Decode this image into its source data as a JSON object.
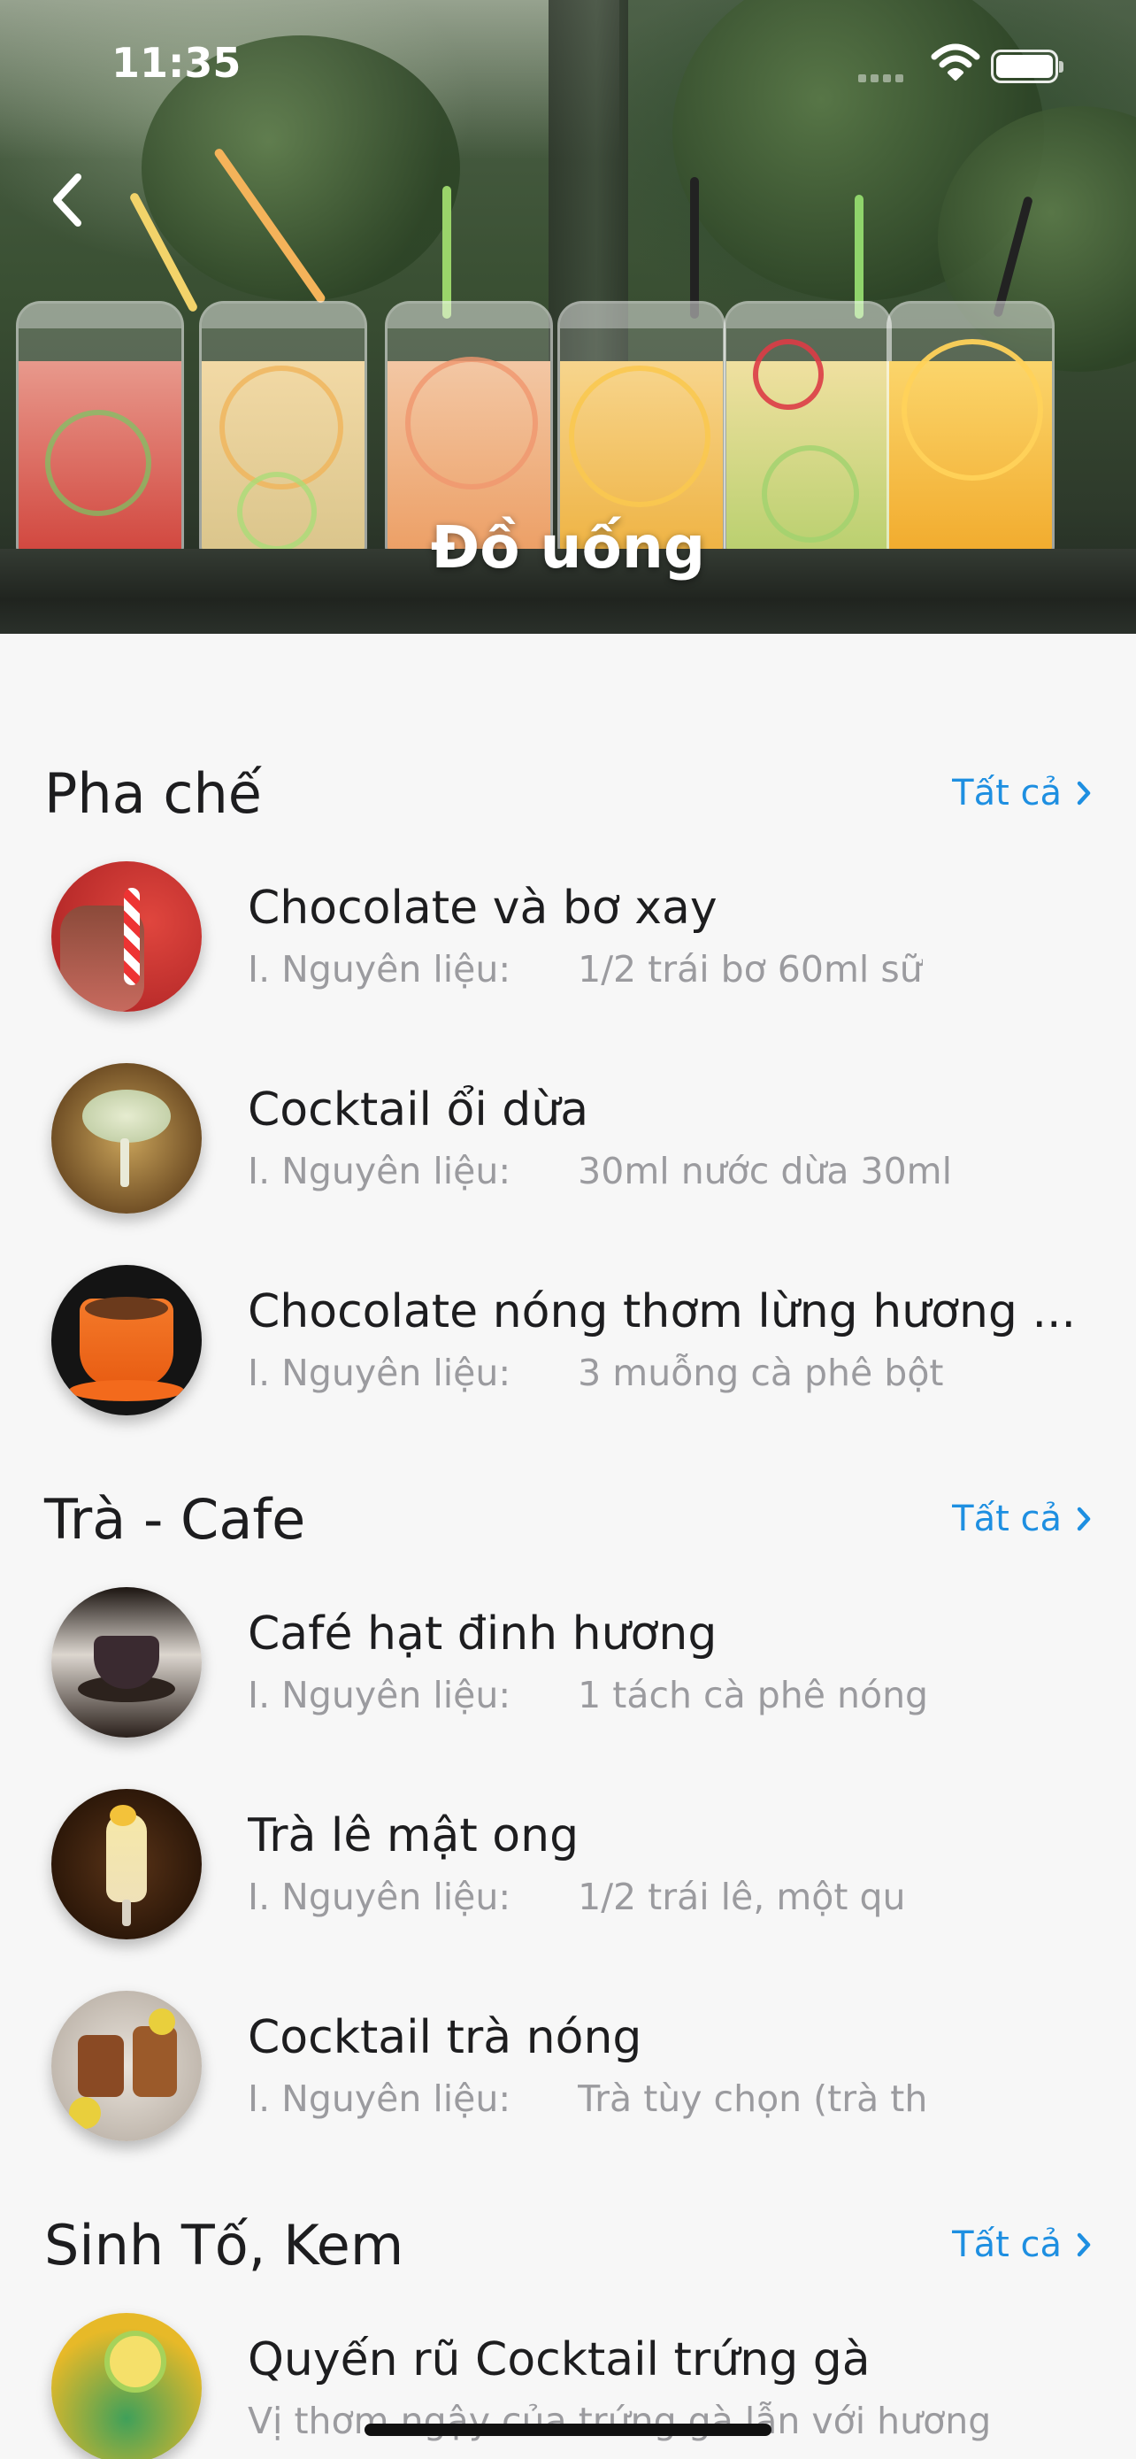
{
  "status_bar": {
    "time": "11:35"
  },
  "header": {
    "title": "Đồ uống"
  },
  "sections": [
    {
      "title": "Pha chế",
      "see_all": "Tất cả",
      "items": [
        {
          "title": "Chocolate và bơ xay",
          "label": "I. Nguyên liệu:",
          "value": "1/2 trái bơ  60ml sữ"
        },
        {
          "title": "Cocktail ổi dừa",
          "label": "I. Nguyên liệu:",
          "value": "30ml nước dừa  30ml"
        },
        {
          "title": "Chocolate nóng thơm lừng hương ...",
          "label": "I. Nguyên liệu:",
          "value": "3 muỗng cà phê bột"
        }
      ]
    },
    {
      "title": "Trà - Cafe",
      "see_all": "Tất cả",
      "items": [
        {
          "title": "Café hạt đinh hương",
          "label": "I. Nguyên liệu:",
          "value": "1 tách cà phê nóng"
        },
        {
          "title": "Trà lê mật ong",
          "label": "I. Nguyên liệu:",
          "value": "1/2 trái lê,  một qu"
        },
        {
          "title": "Cocktail trà nóng",
          "label": "I. Nguyên liệu:",
          "value": "Trà tùy chọn (trà th"
        }
      ]
    },
    {
      "title": "Sinh Tố, Kem",
      "see_all": "Tất cả",
      "items": [
        {
          "title": "Quyến rũ Cocktail trứng gà",
          "label": "",
          "value": "Vị thơm ngậy của trứng gà lẫn với hương"
        }
      ]
    }
  ],
  "colors": {
    "accent": "#1e8fe1",
    "background": "#f7f7f7",
    "muted_text": "#9b9b9f"
  }
}
